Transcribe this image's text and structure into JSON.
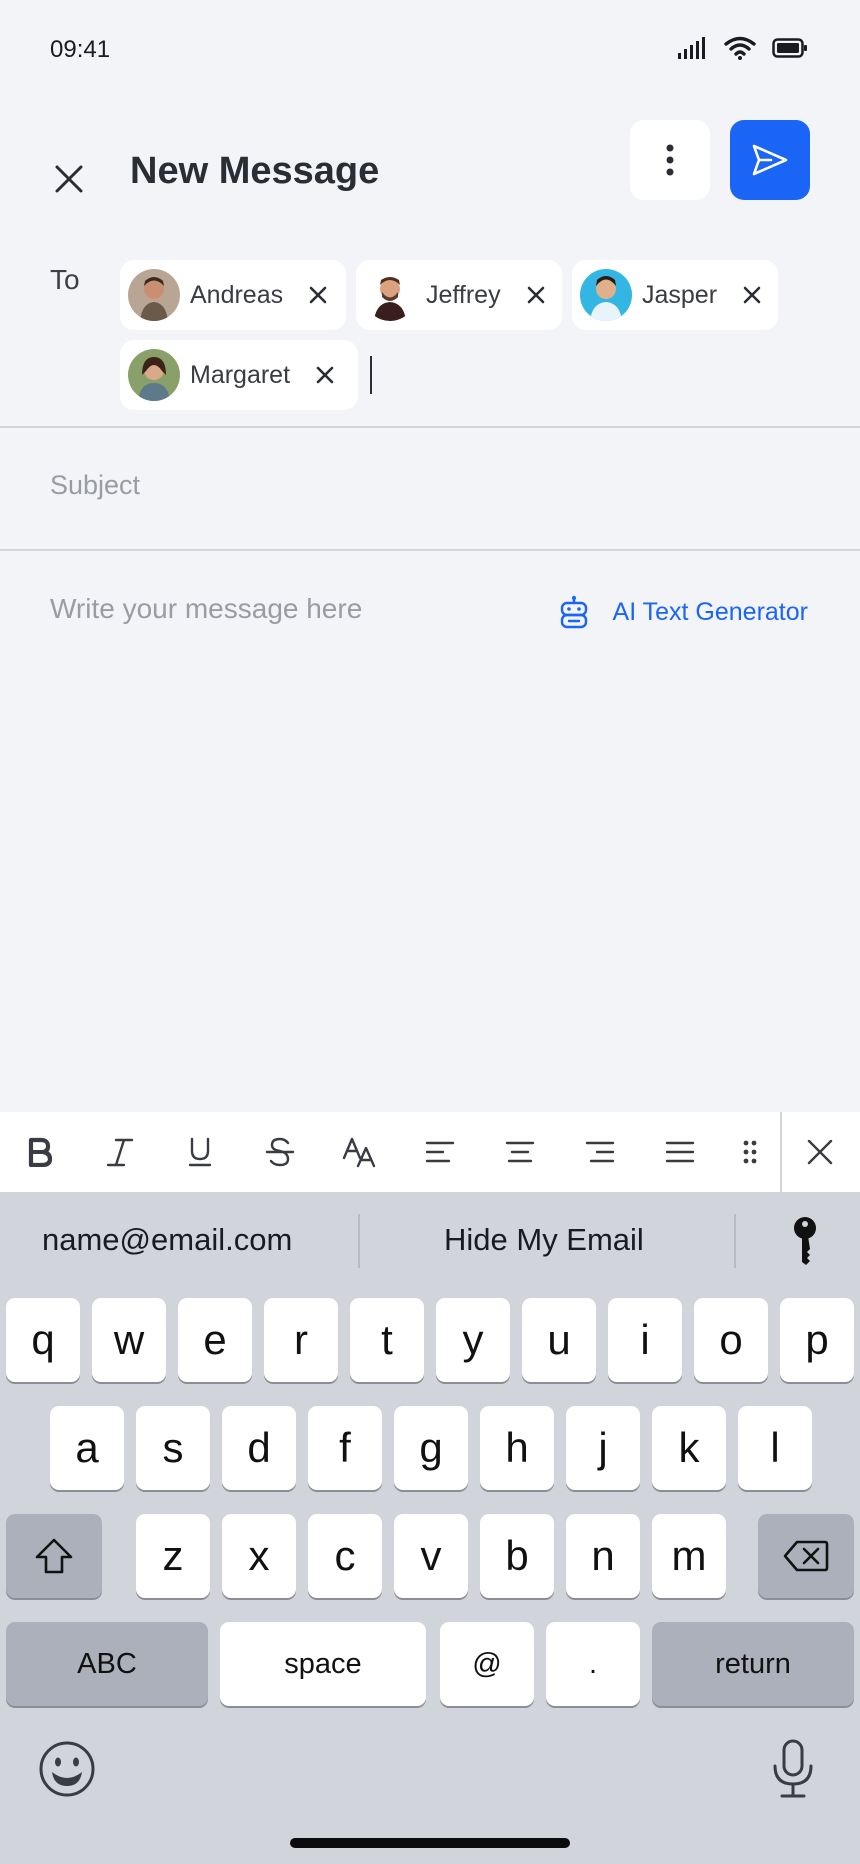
{
  "status": {
    "time": "09:41"
  },
  "header": {
    "title": "New Message"
  },
  "to": {
    "label": "To",
    "recipients": [
      {
        "name": "Andreas"
      },
      {
        "name": "Jeffrey"
      },
      {
        "name": "Jasper"
      },
      {
        "name": "Margaret"
      }
    ]
  },
  "subject": {
    "placeholder": "Subject"
  },
  "message": {
    "placeholder": "Write your message here",
    "ai_label": "AI Text Generator"
  },
  "colors": {
    "accent": "#1a65f5",
    "background": "#f2f4f8",
    "keyboard": "#d1d4da"
  },
  "toolbar": {
    "icons": [
      "bold-icon",
      "italic-icon",
      "underline-icon",
      "strikethrough-icon",
      "text-size-icon",
      "align-left-icon",
      "align-center-icon",
      "align-right-icon",
      "align-justify-icon",
      "drag-handle-icon",
      "close-icon"
    ]
  },
  "keyboard": {
    "suggestions": [
      "name@email.com",
      "Hide My Email"
    ],
    "row1": [
      "q",
      "w",
      "e",
      "r",
      "t",
      "y",
      "u",
      "i",
      "o",
      "p"
    ],
    "row2": [
      "a",
      "s",
      "d",
      "f",
      "g",
      "h",
      "j",
      "k",
      "l"
    ],
    "row3": [
      "z",
      "x",
      "c",
      "v",
      "b",
      "n",
      "m"
    ],
    "abc": "ABC",
    "space": "space",
    "at": "@",
    "dot": ".",
    "return": "return"
  }
}
